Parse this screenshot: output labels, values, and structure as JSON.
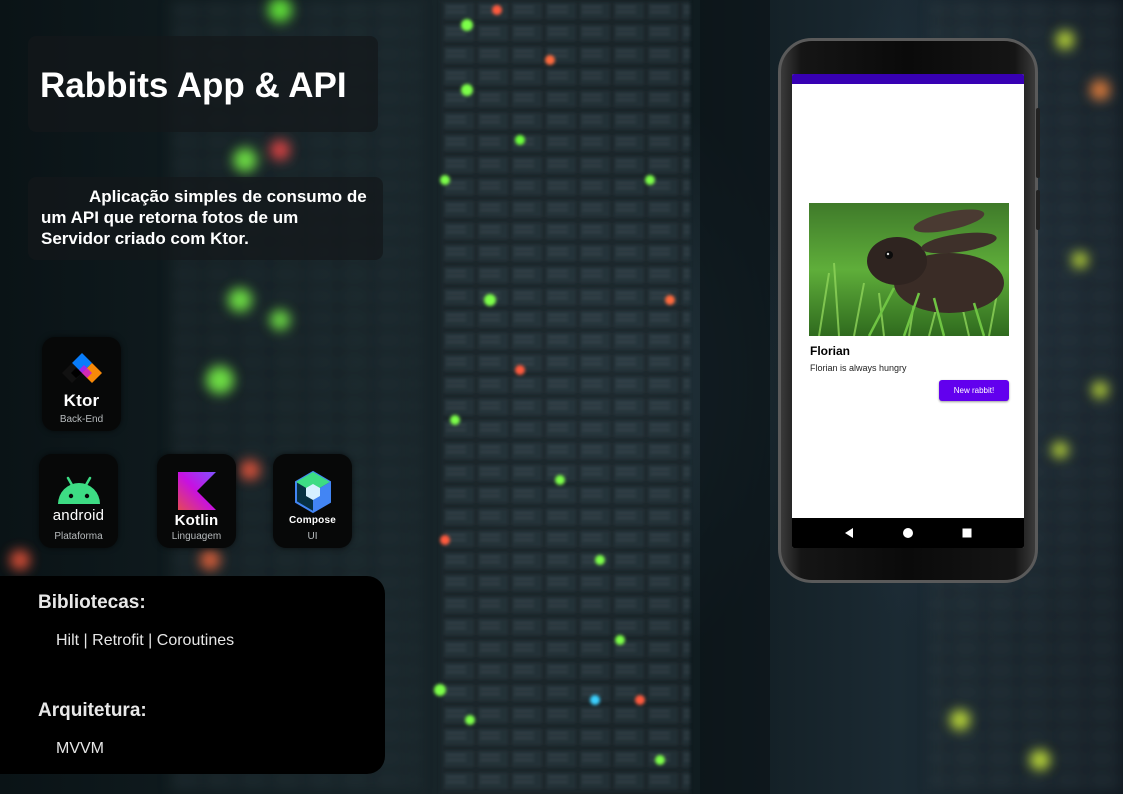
{
  "header": {
    "title": "Rabbits App & API",
    "description": "Aplicação simples de consumo de um API que retorna fotos de um Servidor criado com Ktor."
  },
  "tech": [
    {
      "logo_text": "Ktor",
      "caption": "Back-End",
      "icon": "ktor-icon"
    },
    {
      "logo_text": "android",
      "caption": "Plataforma",
      "icon": "android-icon"
    },
    {
      "logo_text": "Kotlin",
      "caption": "Linguagem",
      "icon": "kotlin-icon"
    },
    {
      "logo_text": "Compose",
      "caption": "UI",
      "icon": "jetpack-compose-icon"
    }
  ],
  "libraries": {
    "heading": "Bibliotecas:",
    "text": "Hilt | Retrofit | Coroutines"
  },
  "architecture": {
    "heading": "Arquitetura:",
    "text": "MVVM"
  },
  "phone": {
    "rabbit_name": "Florian",
    "rabbit_description": "Florian is always hungry",
    "button_label": "New rabbit!",
    "statusbar_color": "#3700b3",
    "button_color": "#6200ee",
    "nav_icons": [
      "back-icon",
      "home-icon",
      "recents-icon"
    ]
  },
  "colors": {
    "kotlin_gradient": [
      "#e44857",
      "#c711e1",
      "#7f52ff"
    ],
    "android_green": "#3ddc84",
    "ktor_orange": "#f88909",
    "ktor_blue": "#087cfa"
  }
}
